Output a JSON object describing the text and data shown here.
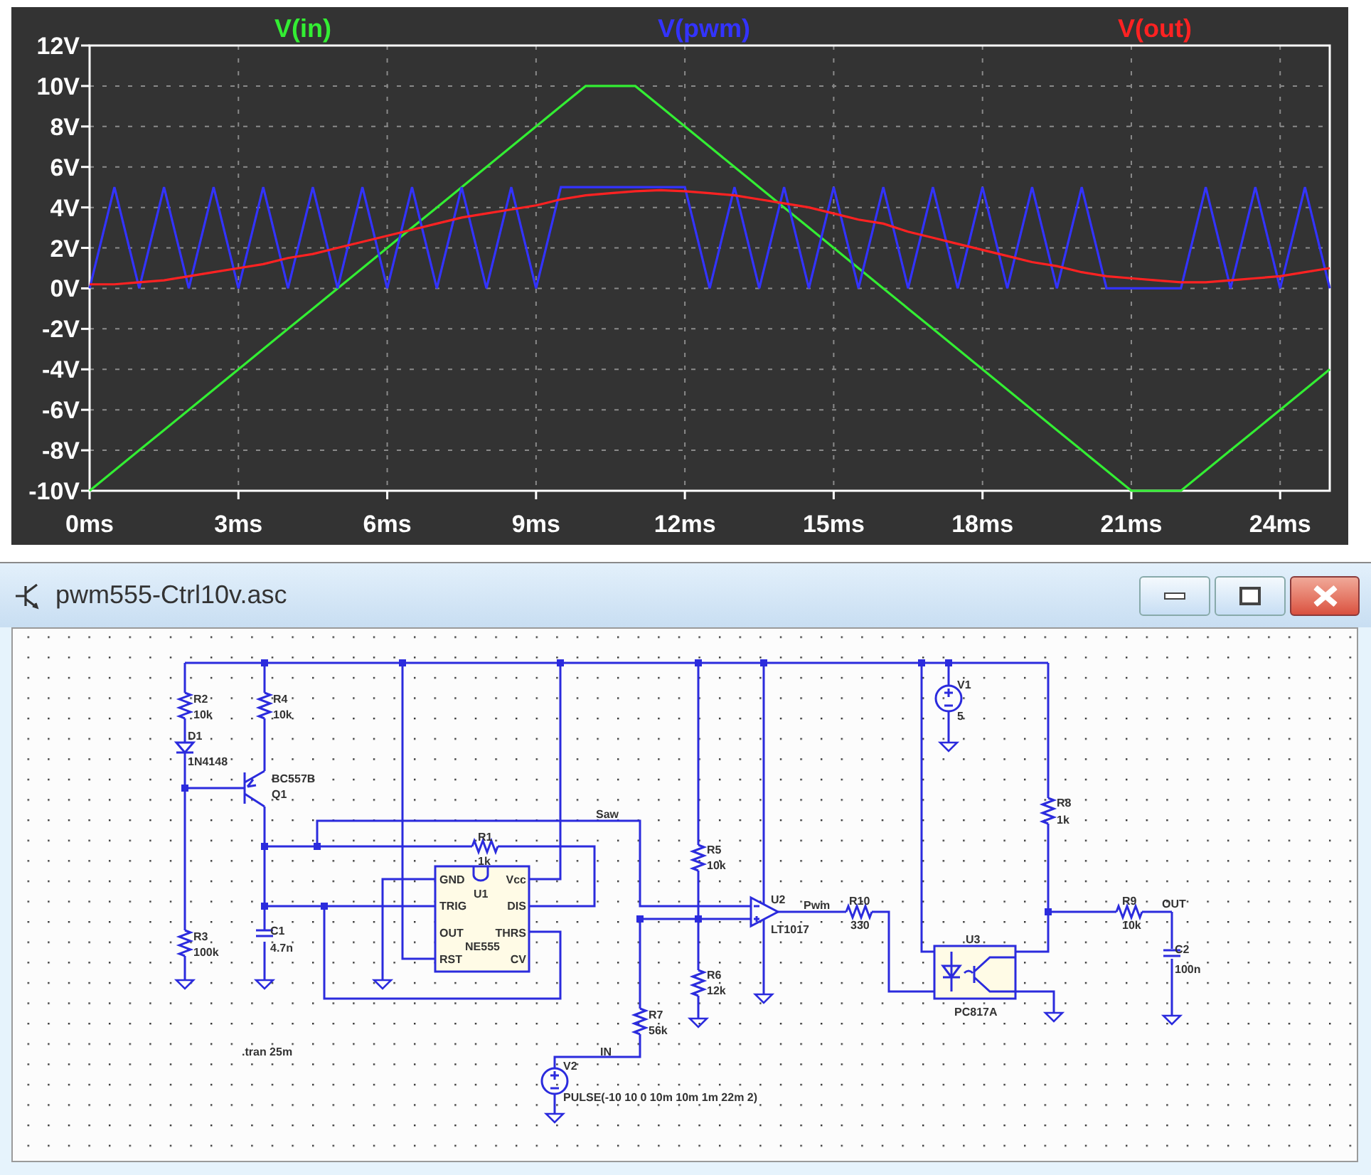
{
  "plot": {
    "chart_data": {
      "type": "line",
      "grid": true,
      "xlim": [
        0,
        25
      ],
      "ylim": [
        -10,
        12
      ],
      "xticks": [
        {
          "value": 0,
          "label": "0ms"
        },
        {
          "value": 3,
          "label": "3ms"
        },
        {
          "value": 6,
          "label": "6ms"
        },
        {
          "value": 9,
          "label": "9ms"
        },
        {
          "value": 12,
          "label": "12ms"
        },
        {
          "value": 15,
          "label": "15ms"
        },
        {
          "value": 18,
          "label": "18ms"
        },
        {
          "value": 21,
          "label": "21ms"
        },
        {
          "value": 24,
          "label": "24ms"
        }
      ],
      "yticks": [
        {
          "value": 12,
          "label": "12V"
        },
        {
          "value": 10,
          "label": "10V"
        },
        {
          "value": 8,
          "label": "8V"
        },
        {
          "value": 6,
          "label": "6V"
        },
        {
          "value": 4,
          "label": "4V"
        },
        {
          "value": 2,
          "label": "2V"
        },
        {
          "value": 0,
          "label": "0V"
        },
        {
          "value": -2,
          "label": "-2V"
        },
        {
          "value": -4,
          "label": "-4V"
        },
        {
          "value": -6,
          "label": "-6V"
        },
        {
          "value": -8,
          "label": "-8V"
        },
        {
          "value": -10,
          "label": "-10V"
        }
      ],
      "x": [
        0,
        0.5,
        1,
        1.5,
        2,
        2.5,
        3,
        3.5,
        4,
        4.5,
        5,
        5.5,
        6,
        6.5,
        7,
        7.5,
        8,
        8.5,
        9,
        9.5,
        10,
        10.5,
        11,
        11.5,
        12,
        12.5,
        13,
        13.5,
        14,
        14.5,
        15,
        15.5,
        16,
        16.5,
        17,
        17.5,
        18,
        18.5,
        19,
        19.5,
        20,
        20.5,
        21,
        21.5,
        22,
        22.5,
        23,
        23.5,
        24,
        24.5,
        25
      ],
      "series": [
        {
          "name": "V(in)",
          "color": "#33ee33",
          "values": [
            -10,
            -9,
            -8,
            -7,
            -6,
            -5,
            -4,
            -3,
            -2,
            -1,
            0,
            1,
            2,
            3,
            4,
            5,
            6,
            7,
            8,
            9,
            10,
            10,
            10,
            9,
            8,
            7,
            6,
            5,
            4,
            3,
            2,
            1,
            0,
            -1,
            -2,
            -3,
            -4,
            -5,
            -6,
            -7,
            -8,
            -9,
            -10,
            -10,
            -10,
            -9,
            -8,
            -7,
            -6,
            -5,
            -4
          ]
        },
        {
          "name": "V(pwm)",
          "color": "#3333ff",
          "values": [
            0,
            5,
            0,
            5,
            0,
            5,
            0,
            5,
            0,
            5,
            0,
            5,
            0,
            5,
            0,
            5,
            0,
            5,
            0,
            5,
            5,
            5,
            5,
            5,
            5,
            0,
            5,
            0,
            5,
            0,
            5,
            0,
            5,
            0,
            5,
            0,
            5,
            0,
            5,
            0,
            5,
            0,
            0,
            0,
            0,
            5,
            0,
            5,
            0,
            5,
            0
          ]
        },
        {
          "name": "V(out)",
          "color": "#ff2222",
          "values": [
            0.2,
            0.2,
            0.3,
            0.4,
            0.6,
            0.8,
            1.0,
            1.2,
            1.5,
            1.7,
            2.0,
            2.3,
            2.6,
            2.9,
            3.2,
            3.5,
            3.7,
            3.9,
            4.1,
            4.4,
            4.6,
            4.7,
            4.8,
            4.85,
            4.8,
            4.7,
            4.6,
            4.4,
            4.2,
            4.0,
            3.7,
            3.4,
            3.2,
            2.8,
            2.5,
            2.2,
            1.9,
            1.6,
            1.3,
            1.1,
            0.8,
            0.6,
            0.5,
            0.4,
            0.3,
            0.3,
            0.4,
            0.5,
            0.6,
            0.8,
            1.0
          ]
        }
      ]
    }
  },
  "window": {
    "title": "pwm555-Ctrl10v.asc"
  },
  "schematic": {
    "components": [
      {
        "ref": "R2",
        "value": "10k"
      },
      {
        "ref": "D1",
        "value": "1N4148"
      },
      {
        "ref": "R3",
        "value": "100k"
      },
      {
        "ref": "R4",
        "value": "10k"
      },
      {
        "ref": "Q1",
        "value": "BC557B"
      },
      {
        "ref": "C1",
        "value": "4.7n"
      },
      {
        "ref": "R1",
        "value": "1k"
      },
      {
        "ref": "U1",
        "value": "NE555"
      },
      {
        "ref": "R7",
        "value": "56k"
      },
      {
        "ref": "V2",
        "value": "PULSE(-10 10 0 10m 10m 1m 22m 2)"
      },
      {
        "ref": "R5",
        "value": "10k"
      },
      {
        "ref": "R6",
        "value": "12k"
      },
      {
        "ref": "U2",
        "value": "LT1017"
      },
      {
        "ref": "R10",
        "value": "330"
      },
      {
        "ref": "V1",
        "value": "5"
      },
      {
        "ref": "U3",
        "value": "PC817A"
      },
      {
        "ref": "R8",
        "value": "1k"
      },
      {
        "ref": "R9",
        "value": "10k"
      },
      {
        "ref": "C2",
        "value": "100n"
      }
    ],
    "u1_pins_left": [
      "GND",
      "TRIG",
      "OUT",
      "RST"
    ],
    "u1_pins_right": [
      "Vcc",
      "DIS",
      "THRS",
      "CV"
    ],
    "net_labels": [
      "Saw",
      "Pwm",
      "IN",
      "OUT"
    ],
    "directive": ".tran 25m"
  }
}
